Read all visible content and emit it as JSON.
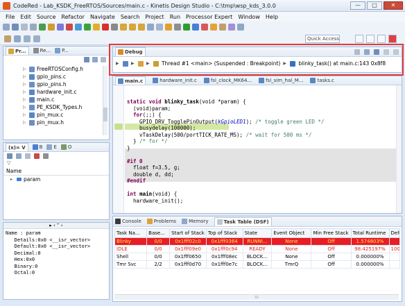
{
  "window": {
    "title": "CodeRed - Lab_KSDK_FreeRTOS/Sources/main.c - Kinetis Design Studio - C:\\tmp\\wsp_kds_3.0.0",
    "minimize": "—",
    "maximize": "□",
    "close": "✕"
  },
  "menu": [
    "File",
    "Edit",
    "Source",
    "Refactor",
    "Navigate",
    "Search",
    "Project",
    "Run",
    "Processor Expert",
    "Window",
    "Help"
  ],
  "toolbar": {
    "quick_access": "Quick Access"
  },
  "project_explorer": {
    "tabs": [
      "Pr...",
      "Re...",
      "P..."
    ],
    "files": [
      "FreeRTOSConfig.h",
      "gpio_pins.c",
      "gpio_pins.h",
      "hardware_init.c",
      "main.c",
      "PE_KSDK_Types.h",
      "pin_mux.c",
      "pin_mux.h"
    ]
  },
  "variables": {
    "tabs": [
      "(x)= V",
      "B",
      "E",
      "O"
    ],
    "name_header": "Name",
    "rows": [
      "param"
    ]
  },
  "detail_text": "Name : param\n   Details:0x0 <__isr_vector>\n   Default:0x0 <__isr_vector>\n   Decimal:0\n   Hex:0x0\n   Binary:0\n   Octal:0",
  "debug_view": {
    "tab": "Debug",
    "stack_label": "Thread #1 <main> (Suspended : Breakpoint)",
    "frame_label": "blinky_task() at main.c:143 0x8f8"
  },
  "editor": {
    "tabs": [
      "main.c",
      "hardware_init.c",
      "fsl_clock_MK64...",
      "fsl_sim_hal_M...",
      "tasks.c"
    ],
    "code": [
      {
        "seg": [
          {
            "t": "static void ",
            "c": "kw"
          },
          {
            "t": "blinky_task",
            "c": "fn"
          },
          {
            "t": "(void *param) {",
            "c": ""
          }
        ]
      },
      {
        "seg": [
          {
            "t": "  (void)param;",
            "c": ""
          }
        ]
      },
      {
        "seg": [
          {
            "t": "  ",
            "c": ""
          },
          {
            "t": "for",
            "c": "kw"
          },
          {
            "t": "(;;) {",
            "c": ""
          }
        ]
      },
      {
        "seg": [
          {
            "t": "    GPIO_DRV_TogglePinOutput(",
            "c": ""
          },
          {
            "t": "kGpioLED1",
            "c": "it"
          },
          {
            "t": "); ",
            "c": ""
          },
          {
            "t": "/* toggle green LED */",
            "c": "cm"
          }
        ]
      },
      {
        "seg": [
          {
            "t": "    busydelay(100000);",
            "c": ""
          }
        ]
      },
      {
        "seg": [
          {
            "t": "    vTaskDelay(500/portTICK_RATE_MS); ",
            "c": ""
          },
          {
            "t": "/* wait for 500 ms */",
            "c": "cm"
          }
        ]
      },
      {
        "seg": [
          {
            "t": "  } ",
            "c": ""
          },
          {
            "t": "/* for */",
            "c": "cm"
          }
        ]
      },
      {
        "seg": [
          {
            "t": "}",
            "c": ""
          }
        ]
      },
      {
        "seg": [
          {
            "t": "",
            "c": ""
          }
        ]
      },
      {
        "seg": [
          {
            "t": "#if 0",
            "c": "kw"
          }
        ]
      },
      {
        "seg": [
          {
            "t": "  float f=3.5, g;",
            "c": ""
          }
        ]
      },
      {
        "seg": [
          {
            "t": "  double d, dd;",
            "c": ""
          }
        ]
      },
      {
        "seg": [
          {
            "t": "#endif",
            "c": "kw"
          }
        ]
      },
      {
        "seg": [
          {
            "t": "",
            "c": ""
          }
        ]
      },
      {
        "seg": [
          {
            "t": "int ",
            "c": "kw"
          },
          {
            "t": "main",
            "c": "fn"
          },
          {
            "t": "(void) {",
            "c": ""
          }
        ]
      },
      {
        "seg": [
          {
            "t": "  hardware_init();",
            "c": ""
          }
        ]
      }
    ]
  },
  "bottom": {
    "tabs": [
      "Console",
      "Problems",
      "Memory",
      "Task Table (DSF)"
    ],
    "columns": [
      "Task Na...",
      "Base...",
      "Start of Stack",
      "Top of Stack",
      "State",
      "Event Object",
      "Min Free Stack",
      "Total Runtime",
      "Delt"
    ],
    "rows": [
      {
        "style": "r-red",
        "cells": [
          "Blinky",
          "0/0",
          "0x1fff02c0",
          "0x1fff0364",
          "RUNNI...",
          "None",
          "Off",
          "1.574803%",
          ""
        ]
      },
      {
        "style": "r-white",
        "cells": [
          "IDLE",
          "0/0",
          "0x1fff09e0",
          "0x1fff0c94",
          "READY",
          "None",
          "Off",
          "98.425197%",
          "100"
        ]
      },
      {
        "style": "",
        "cells": [
          "Shell",
          "0/0",
          "0x1fff0650",
          "0x1fff08ec",
          "BLOCK...",
          "None",
          "Off",
          "0.000000%",
          ""
        ]
      },
      {
        "style": "",
        "cells": [
          "Tmr Svc",
          "2/2",
          "0x1fff0d70",
          "0x1fff0e7c",
          "BLOCK...",
          "TmrQ",
          "Off",
          "0.000000%",
          ""
        ]
      }
    ]
  },
  "colors": {
    "highlight_border": "#e23a3a",
    "running_row": "#e81d25",
    "running_text": "#ffe34f"
  }
}
